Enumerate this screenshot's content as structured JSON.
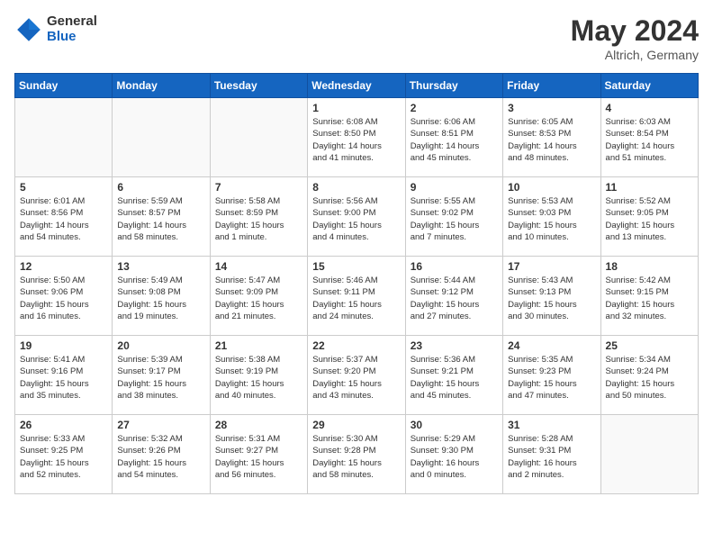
{
  "header": {
    "logo_general": "General",
    "logo_blue": "Blue",
    "title": "May 2024",
    "location": "Altrich, Germany"
  },
  "weekdays": [
    "Sunday",
    "Monday",
    "Tuesday",
    "Wednesday",
    "Thursday",
    "Friday",
    "Saturday"
  ],
  "weeks": [
    [
      {
        "day": "",
        "info": ""
      },
      {
        "day": "",
        "info": ""
      },
      {
        "day": "",
        "info": ""
      },
      {
        "day": "1",
        "info": "Sunrise: 6:08 AM\nSunset: 8:50 PM\nDaylight: 14 hours\nand 41 minutes."
      },
      {
        "day": "2",
        "info": "Sunrise: 6:06 AM\nSunset: 8:51 PM\nDaylight: 14 hours\nand 45 minutes."
      },
      {
        "day": "3",
        "info": "Sunrise: 6:05 AM\nSunset: 8:53 PM\nDaylight: 14 hours\nand 48 minutes."
      },
      {
        "day": "4",
        "info": "Sunrise: 6:03 AM\nSunset: 8:54 PM\nDaylight: 14 hours\nand 51 minutes."
      }
    ],
    [
      {
        "day": "5",
        "info": "Sunrise: 6:01 AM\nSunset: 8:56 PM\nDaylight: 14 hours\nand 54 minutes."
      },
      {
        "day": "6",
        "info": "Sunrise: 5:59 AM\nSunset: 8:57 PM\nDaylight: 14 hours\nand 58 minutes."
      },
      {
        "day": "7",
        "info": "Sunrise: 5:58 AM\nSunset: 8:59 PM\nDaylight: 15 hours\nand 1 minute."
      },
      {
        "day": "8",
        "info": "Sunrise: 5:56 AM\nSunset: 9:00 PM\nDaylight: 15 hours\nand 4 minutes."
      },
      {
        "day": "9",
        "info": "Sunrise: 5:55 AM\nSunset: 9:02 PM\nDaylight: 15 hours\nand 7 minutes."
      },
      {
        "day": "10",
        "info": "Sunrise: 5:53 AM\nSunset: 9:03 PM\nDaylight: 15 hours\nand 10 minutes."
      },
      {
        "day": "11",
        "info": "Sunrise: 5:52 AM\nSunset: 9:05 PM\nDaylight: 15 hours\nand 13 minutes."
      }
    ],
    [
      {
        "day": "12",
        "info": "Sunrise: 5:50 AM\nSunset: 9:06 PM\nDaylight: 15 hours\nand 16 minutes."
      },
      {
        "day": "13",
        "info": "Sunrise: 5:49 AM\nSunset: 9:08 PM\nDaylight: 15 hours\nand 19 minutes."
      },
      {
        "day": "14",
        "info": "Sunrise: 5:47 AM\nSunset: 9:09 PM\nDaylight: 15 hours\nand 21 minutes."
      },
      {
        "day": "15",
        "info": "Sunrise: 5:46 AM\nSunset: 9:11 PM\nDaylight: 15 hours\nand 24 minutes."
      },
      {
        "day": "16",
        "info": "Sunrise: 5:44 AM\nSunset: 9:12 PM\nDaylight: 15 hours\nand 27 minutes."
      },
      {
        "day": "17",
        "info": "Sunrise: 5:43 AM\nSunset: 9:13 PM\nDaylight: 15 hours\nand 30 minutes."
      },
      {
        "day": "18",
        "info": "Sunrise: 5:42 AM\nSunset: 9:15 PM\nDaylight: 15 hours\nand 32 minutes."
      }
    ],
    [
      {
        "day": "19",
        "info": "Sunrise: 5:41 AM\nSunset: 9:16 PM\nDaylight: 15 hours\nand 35 minutes."
      },
      {
        "day": "20",
        "info": "Sunrise: 5:39 AM\nSunset: 9:17 PM\nDaylight: 15 hours\nand 38 minutes."
      },
      {
        "day": "21",
        "info": "Sunrise: 5:38 AM\nSunset: 9:19 PM\nDaylight: 15 hours\nand 40 minutes."
      },
      {
        "day": "22",
        "info": "Sunrise: 5:37 AM\nSunset: 9:20 PM\nDaylight: 15 hours\nand 43 minutes."
      },
      {
        "day": "23",
        "info": "Sunrise: 5:36 AM\nSunset: 9:21 PM\nDaylight: 15 hours\nand 45 minutes."
      },
      {
        "day": "24",
        "info": "Sunrise: 5:35 AM\nSunset: 9:23 PM\nDaylight: 15 hours\nand 47 minutes."
      },
      {
        "day": "25",
        "info": "Sunrise: 5:34 AM\nSunset: 9:24 PM\nDaylight: 15 hours\nand 50 minutes."
      }
    ],
    [
      {
        "day": "26",
        "info": "Sunrise: 5:33 AM\nSunset: 9:25 PM\nDaylight: 15 hours\nand 52 minutes."
      },
      {
        "day": "27",
        "info": "Sunrise: 5:32 AM\nSunset: 9:26 PM\nDaylight: 15 hours\nand 54 minutes."
      },
      {
        "day": "28",
        "info": "Sunrise: 5:31 AM\nSunset: 9:27 PM\nDaylight: 15 hours\nand 56 minutes."
      },
      {
        "day": "29",
        "info": "Sunrise: 5:30 AM\nSunset: 9:28 PM\nDaylight: 15 hours\nand 58 minutes."
      },
      {
        "day": "30",
        "info": "Sunrise: 5:29 AM\nSunset: 9:30 PM\nDaylight: 16 hours\nand 0 minutes."
      },
      {
        "day": "31",
        "info": "Sunrise: 5:28 AM\nSunset: 9:31 PM\nDaylight: 16 hours\nand 2 minutes."
      },
      {
        "day": "",
        "info": ""
      }
    ]
  ]
}
